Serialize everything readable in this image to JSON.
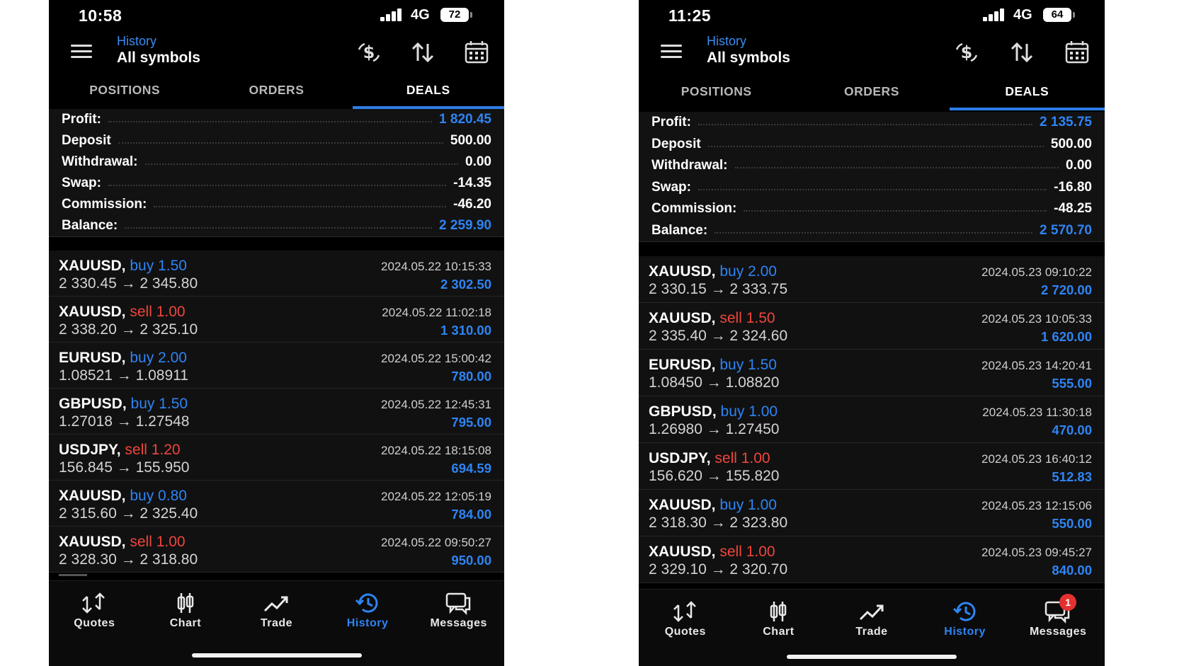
{
  "phones": [
    {
      "status": {
        "time": "10:58",
        "network": "4G",
        "battery": "72"
      },
      "header": {
        "subtitle": "History",
        "title": "All symbols"
      },
      "tabs": [
        "POSITIONS",
        "ORDERS",
        "DEALS"
      ],
      "active_tab": "DEALS",
      "summary": [
        {
          "label": "Profit:",
          "value": "1 820.45",
          "color": "blue"
        },
        {
          "label": "Deposit",
          "value": "500.00",
          "color": "white"
        },
        {
          "label": "Withdrawal:",
          "value": "0.00",
          "color": "white"
        },
        {
          "label": "Swap:",
          "value": "-14.35",
          "color": "white"
        },
        {
          "label": "Commission:",
          "value": "-46.20",
          "color": "white"
        },
        {
          "label": "Balance:",
          "value": "2 259.90",
          "color": "blue"
        }
      ],
      "deals": [
        {
          "symbol": "XAUUSD,",
          "side": "buy 1.50",
          "side_type": "buy",
          "prices": "2 330.45 → 2 345.80",
          "time": "2024.05.22 10:15:33",
          "profit": "2 302.50"
        },
        {
          "symbol": "XAUUSD,",
          "side": "sell 1.00",
          "side_type": "sell",
          "prices": "2 338.20 → 2 325.10",
          "time": "2024.05.22 11:02:18",
          "profit": "1 310.00"
        },
        {
          "symbol": "EURUSD,",
          "side": "buy 2.00",
          "side_type": "buy",
          "prices": "1.08521 → 1.08911",
          "time": "2024.05.22 15:00:42",
          "profit": "780.00"
        },
        {
          "symbol": "GBPUSD,",
          "side": "buy 1.50",
          "side_type": "buy",
          "prices": "1.27018 → 1.27548",
          "time": "2024.05.22 12:45:31",
          "profit": "795.00"
        },
        {
          "symbol": "USDJPY,",
          "side": "sell 1.20",
          "side_type": "sell",
          "prices": "156.845 → 155.950",
          "time": "2024.05.22 18:15:08",
          "profit": "694.59"
        },
        {
          "symbol": "XAUUSD,",
          "side": "buy 0.80",
          "side_type": "buy",
          "prices": "2 315.60 → 2 325.40",
          "time": "2024.05.22 12:05:19",
          "profit": "784.00"
        },
        {
          "symbol": "XAUUSD,",
          "side": "sell 1.00",
          "side_type": "sell",
          "prices": "2 328.30 → 2 318.80",
          "time": "2024.05.22 09:50:27",
          "profit": "950.00"
        }
      ],
      "nav": [
        {
          "label": "Quotes",
          "icon": "quotes-icon",
          "active": false,
          "badge": ""
        },
        {
          "label": "Chart",
          "icon": "chart-icon",
          "active": false,
          "badge": ""
        },
        {
          "label": "Trade",
          "icon": "trade-icon",
          "active": false,
          "badge": ""
        },
        {
          "label": "History",
          "icon": "history-icon",
          "active": true,
          "badge": ""
        },
        {
          "label": "Messages",
          "icon": "messages-icon",
          "active": false,
          "badge": ""
        }
      ]
    },
    {
      "status": {
        "time": "11:25",
        "network": "4G",
        "battery": "64"
      },
      "header": {
        "subtitle": "History",
        "title": "All symbols"
      },
      "tabs": [
        "POSITIONS",
        "ORDERS",
        "DEALS"
      ],
      "active_tab": "DEALS",
      "summary": [
        {
          "label": "Profit:",
          "value": "2 135.75",
          "color": "blue"
        },
        {
          "label": "Deposit",
          "value": "500.00",
          "color": "white"
        },
        {
          "label": "Withdrawal:",
          "value": "0.00",
          "color": "white"
        },
        {
          "label": "Swap:",
          "value": "-16.80",
          "color": "white"
        },
        {
          "label": "Commission:",
          "value": "-48.25",
          "color": "white"
        },
        {
          "label": "Balance:",
          "value": "2 570.70",
          "color": "blue"
        }
      ],
      "deals": [
        {
          "symbol": "XAUUSD,",
          "side": "buy 2.00",
          "side_type": "buy",
          "prices": "2 330.15 → 2 333.75",
          "time": "2024.05.23 09:10:22",
          "profit": "2 720.00"
        },
        {
          "symbol": "XAUUSD,",
          "side": "sell 1.50",
          "side_type": "sell",
          "prices": "2 335.40 → 2 324.60",
          "time": "2024.05.23 10:05:33",
          "profit": "1 620.00"
        },
        {
          "symbol": "EURUSD,",
          "side": "buy 1.50",
          "side_type": "buy",
          "prices": "1.08450 → 1.08820",
          "time": "2024.05.23 14:20:41",
          "profit": "555.00"
        },
        {
          "symbol": "GBPUSD,",
          "side": "buy 1.00",
          "side_type": "buy",
          "prices": "1.26980 → 1.27450",
          "time": "2024.05.23 11:30:18",
          "profit": "470.00"
        },
        {
          "symbol": "USDJPY,",
          "side": "sell 1.00",
          "side_type": "sell",
          "prices": "156.620 → 155.820",
          "time": "2024.05.23 16:40:12",
          "profit": "512.83"
        },
        {
          "symbol": "XAUUSD,",
          "side": "buy 1.00",
          "side_type": "buy",
          "prices": "2 318.30 → 2 323.80",
          "time": "2024.05.23 12:15:06",
          "profit": "550.00"
        },
        {
          "symbol": "XAUUSD,",
          "side": "sell 1.00",
          "side_type": "sell",
          "prices": "2 329.10 → 2 320.70",
          "time": "2024.05.23 09:45:27",
          "profit": "840.00"
        }
      ],
      "nav": [
        {
          "label": "Quotes",
          "icon": "quotes-icon",
          "active": false,
          "badge": ""
        },
        {
          "label": "Chart",
          "icon": "chart-icon",
          "active": false,
          "badge": ""
        },
        {
          "label": "Trade",
          "icon": "trade-icon",
          "active": false,
          "badge": ""
        },
        {
          "label": "History",
          "icon": "history-icon",
          "active": true,
          "badge": ""
        },
        {
          "label": "Messages",
          "icon": "messages-icon",
          "active": false,
          "badge": "1"
        }
      ]
    }
  ],
  "colors": {
    "accent_blue": "#2e84f4",
    "sell_red": "#f0463c",
    "background": "#000000"
  },
  "toolbar_icons": [
    "currency-exchange-icon",
    "sort-icon",
    "calendar-icon"
  ]
}
